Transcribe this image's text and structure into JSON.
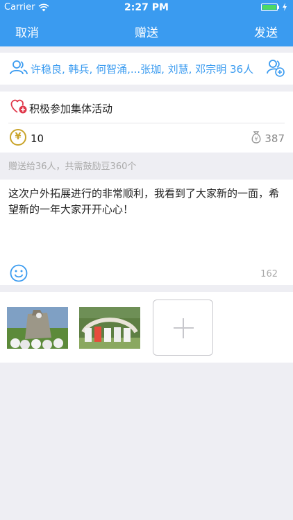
{
  "status_bar": {
    "carrier": "Carrier",
    "time": "2:27 PM"
  },
  "nav": {
    "cancel": "取消",
    "title": "赠送",
    "send": "发送"
  },
  "recipients": {
    "text": "许稳良, 韩兵, 何智涌,...张珈, 刘慧, 邓宗明 36人",
    "icon": "people-icon",
    "add_icon": "add-person-icon"
  },
  "activity": {
    "name": "积极参加集体活动",
    "icon": "heart-plus-icon"
  },
  "reward": {
    "amount": "10",
    "balance": "387",
    "currency_icon": "yen-coin-icon",
    "balance_icon": "money-bag-icon"
  },
  "summary": "赠送给36人，共需鼓励豆360个",
  "message": {
    "text": "这次户外拓展进行的非常顺利，我看到了大家新的一面，希望新的一年大家开开心心！",
    "remaining": "162",
    "emoji_icon": "smiley-icon"
  },
  "photos": {
    "count": 2,
    "add_icon": "plus-icon"
  },
  "colors": {
    "accent": "#3a9bf0",
    "coin": "#c9a42a",
    "heart": "#e0384b",
    "background": "#eeeef3"
  }
}
